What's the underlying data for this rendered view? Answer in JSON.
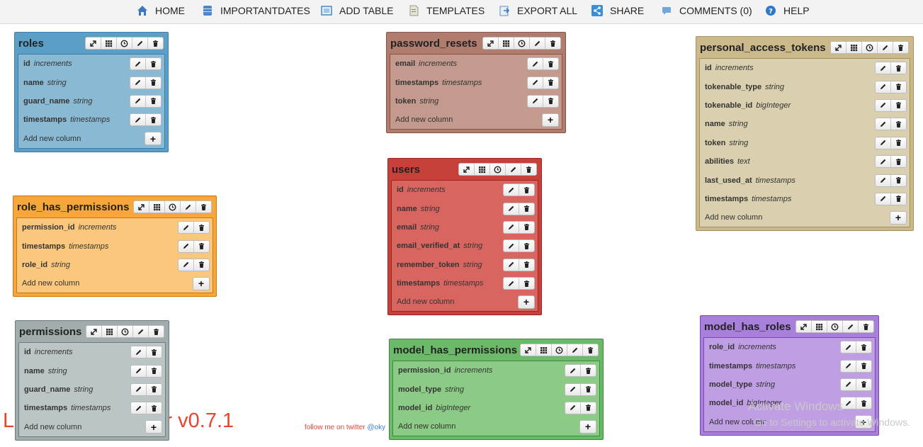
{
  "nav": {
    "home": "HOME",
    "importantdates": "IMPORTANTDATES",
    "add_table": "ADD TABLE",
    "templates": "TEMPLATES",
    "export_all": "EXPORT ALL",
    "share": "SHARE",
    "comments": "COMMENTS (0)",
    "help": "HELP"
  },
  "add_label": "Add new column",
  "footer": {
    "credit": "Laravel Schema Designer v0.7.1",
    "credit_visible": "L                esigner v0.7.1",
    "follow": "follow me on twitter ",
    "handle": "@oky"
  },
  "watermark": {
    "line1": "Activate Windows",
    "line2": "Go to Settings to activate Windows."
  },
  "tables": [
    {
      "name": "roles",
      "columns": [
        {
          "name": "id",
          "type": "increments"
        },
        {
          "name": "name",
          "type": "string"
        },
        {
          "name": "guard_name",
          "type": "string"
        },
        {
          "name": "timestamps",
          "type": "timestamps"
        }
      ]
    },
    {
      "name": "password_resets",
      "columns": [
        {
          "name": "email",
          "type": "increments"
        },
        {
          "name": "timestamps",
          "type": "timestamps"
        },
        {
          "name": "token",
          "type": "string"
        }
      ]
    },
    {
      "name": "personal_access_tokens",
      "columns": [
        {
          "name": "id",
          "type": "increments"
        },
        {
          "name": "tokenable_type",
          "type": "string"
        },
        {
          "name": "tokenable_id",
          "type": "bigInteger"
        },
        {
          "name": "name",
          "type": "string"
        },
        {
          "name": "token",
          "type": "string"
        },
        {
          "name": "abilities",
          "type": "text"
        },
        {
          "name": "last_used_at",
          "type": "timestamps"
        },
        {
          "name": "timestamps",
          "type": "timestamps"
        }
      ]
    },
    {
      "name": "users",
      "columns": [
        {
          "name": "id",
          "type": "increments"
        },
        {
          "name": "name",
          "type": "string"
        },
        {
          "name": "email",
          "type": "string"
        },
        {
          "name": "email_verified_at",
          "type": "string"
        },
        {
          "name": "remember_token",
          "type": "string"
        },
        {
          "name": "timestamps",
          "type": "timestamps"
        }
      ]
    },
    {
      "name": "role_has_permissions",
      "columns": [
        {
          "name": "permission_id",
          "type": "increments"
        },
        {
          "name": "timestamps",
          "type": "timestamps"
        },
        {
          "name": "role_id",
          "type": "string"
        }
      ]
    },
    {
      "name": "permissions",
      "columns": [
        {
          "name": "id",
          "type": "increments"
        },
        {
          "name": "name",
          "type": "string"
        },
        {
          "name": "guard_name",
          "type": "string"
        },
        {
          "name": "timestamps",
          "type": "timestamps"
        }
      ]
    },
    {
      "name": "model_has_permissions",
      "columns": [
        {
          "name": "permission_id",
          "type": "increments"
        },
        {
          "name": "model_type",
          "type": "string"
        },
        {
          "name": "model_id",
          "type": "bigInteger"
        }
      ]
    },
    {
      "name": "model_has_roles",
      "columns": [
        {
          "name": "role_id",
          "type": "increments"
        },
        {
          "name": "timestamps",
          "type": "timestamps"
        },
        {
          "name": "model_type",
          "type": "string"
        },
        {
          "name": "model_id",
          "type": "bigInteger"
        }
      ]
    }
  ],
  "colors": {
    "blue": "#5b9fc7",
    "brown": "#a8695a",
    "tan": "#c2ad7c",
    "red": "#c03a34",
    "orange": "#f19a28",
    "gray": "#8a9799",
    "green": "#5aac5c",
    "purple": "#9a64d0"
  }
}
